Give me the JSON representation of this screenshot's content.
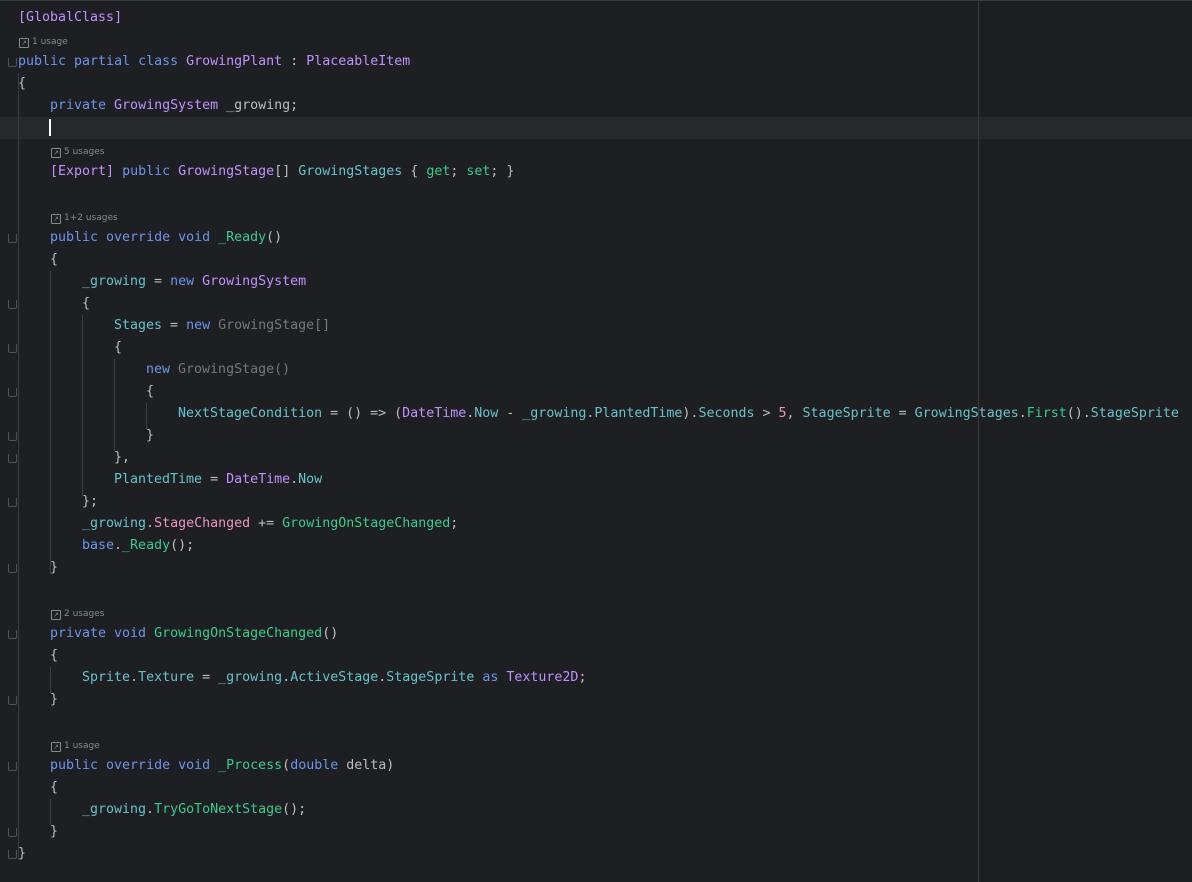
{
  "editor": {
    "usages": {
      "class": "1 usage",
      "stages": "5 usages",
      "ready": "1+2 usages",
      "changed": "2 usages",
      "process": "1 usage"
    },
    "lines": [
      [
        [
          "[GlobalClass]",
          "attr"
        ]
      ],
      [
        [
          "public partial class ",
          "kw2"
        ],
        [
          "GrowingPlant",
          "cls"
        ],
        [
          " : ",
          "op"
        ],
        [
          "PlaceableItem",
          "cls"
        ]
      ],
      [
        [
          "{",
          "op"
        ]
      ],
      [
        [
          "private ",
          "kw2"
        ],
        [
          "GrowingSystem",
          "cls"
        ],
        [
          " _growing;",
          "loc"
        ]
      ],
      [
        [
          "[Export] ",
          "attr"
        ],
        [
          "public ",
          "kw2"
        ],
        [
          "GrowingStage",
          "cls"
        ],
        [
          "[] ",
          "op"
        ],
        [
          "GrowingStages",
          "fld"
        ],
        [
          " { ",
          "op"
        ],
        [
          "get",
          "mth"
        ],
        [
          "; ",
          "op"
        ],
        [
          "set",
          "mth"
        ],
        [
          "; }",
          "op"
        ]
      ],
      [
        [
          "public override void ",
          "kw2"
        ],
        [
          "_Ready",
          "mth"
        ],
        [
          "()",
          "op"
        ]
      ],
      [
        [
          "{",
          "op"
        ]
      ],
      [
        [
          "_growing",
          "fld"
        ],
        [
          " = ",
          "op"
        ],
        [
          "new ",
          "kw2"
        ],
        [
          "GrowingSystem",
          "cls"
        ]
      ],
      [
        [
          "{",
          "op"
        ]
      ],
      [
        [
          "Stages",
          "fld"
        ],
        [
          " = ",
          "op"
        ],
        [
          "new ",
          "kw2"
        ],
        [
          "GrowingStage[]",
          "dim"
        ]
      ],
      [
        [
          "{",
          "op"
        ]
      ],
      [
        [
          "new ",
          "kw2"
        ],
        [
          "GrowingStage()",
          "dim"
        ]
      ],
      [
        [
          "{",
          "op"
        ]
      ],
      [
        [
          "NextStageCondition",
          "fld"
        ],
        [
          " = () => (",
          "op"
        ],
        [
          "DateTime",
          "cls"
        ],
        [
          ".",
          "op"
        ],
        [
          "Now",
          "fld"
        ],
        [
          " - ",
          "op"
        ],
        [
          "_growing",
          "fld"
        ],
        [
          ".",
          "op"
        ],
        [
          "PlantedTime",
          "fld"
        ],
        [
          ").",
          "op"
        ],
        [
          "Seconds",
          "fld"
        ],
        [
          " > ",
          "op"
        ],
        [
          "5",
          "num"
        ],
        [
          ", ",
          "op"
        ],
        [
          "StageSprite",
          "fld"
        ],
        [
          " = ",
          "op"
        ],
        [
          "GrowingStages",
          "fld"
        ],
        [
          ".",
          "op"
        ],
        [
          "First",
          "mth"
        ],
        [
          "().",
          "op"
        ],
        [
          "StageSprite",
          "fld"
        ]
      ],
      [
        [
          "}",
          "op"
        ]
      ],
      [
        [
          "},",
          "op"
        ]
      ],
      [
        [
          "PlantedTime",
          "fld"
        ],
        [
          " = ",
          "op"
        ],
        [
          "DateTime",
          "cls"
        ],
        [
          ".",
          "op"
        ],
        [
          "Now",
          "fld"
        ]
      ],
      [
        [
          "};",
          "op"
        ]
      ],
      [
        [
          "_growing",
          "fld"
        ],
        [
          ".",
          "op"
        ],
        [
          "StageChanged",
          "evt"
        ],
        [
          " += ",
          "op"
        ],
        [
          "GrowingOnStageChanged",
          "mth"
        ],
        [
          ";",
          "op"
        ]
      ],
      [
        [
          "base",
          "kw2"
        ],
        [
          ".",
          "op"
        ],
        [
          "_Ready",
          "mth"
        ],
        [
          "();",
          "op"
        ]
      ],
      [
        [
          "}",
          "op"
        ]
      ],
      [
        [
          "private void ",
          "kw2"
        ],
        [
          "GrowingOnStageChanged",
          "mth"
        ],
        [
          "()",
          "op"
        ]
      ],
      [
        [
          "{",
          "op"
        ]
      ],
      [
        [
          "Sprite",
          "fld"
        ],
        [
          ".",
          "op"
        ],
        [
          "Texture",
          "fld"
        ],
        [
          " = ",
          "op"
        ],
        [
          "_growing",
          "fld"
        ],
        [
          ".",
          "op"
        ],
        [
          "ActiveStage",
          "fld"
        ],
        [
          ".",
          "op"
        ],
        [
          "StageSprite",
          "fld"
        ],
        [
          " as ",
          "kw2"
        ],
        [
          "Texture2D",
          "cls"
        ],
        [
          ";",
          "op"
        ]
      ],
      [
        [
          "}",
          "op"
        ]
      ],
      [
        [
          "public override void ",
          "kw2"
        ],
        [
          "_Process",
          "mth"
        ],
        [
          "(",
          "op"
        ],
        [
          "double ",
          "kw2"
        ],
        [
          "delta",
          "loc"
        ],
        [
          ")",
          "op"
        ]
      ],
      [
        [
          "{",
          "op"
        ]
      ],
      [
        [
          "_growing",
          "fld"
        ],
        [
          ".",
          "op"
        ],
        [
          "TryGoToNextStage",
          "mth"
        ],
        [
          "();",
          "op"
        ]
      ],
      [
        [
          "}",
          "op"
        ]
      ],
      [
        [
          "}",
          "op"
        ]
      ]
    ]
  }
}
